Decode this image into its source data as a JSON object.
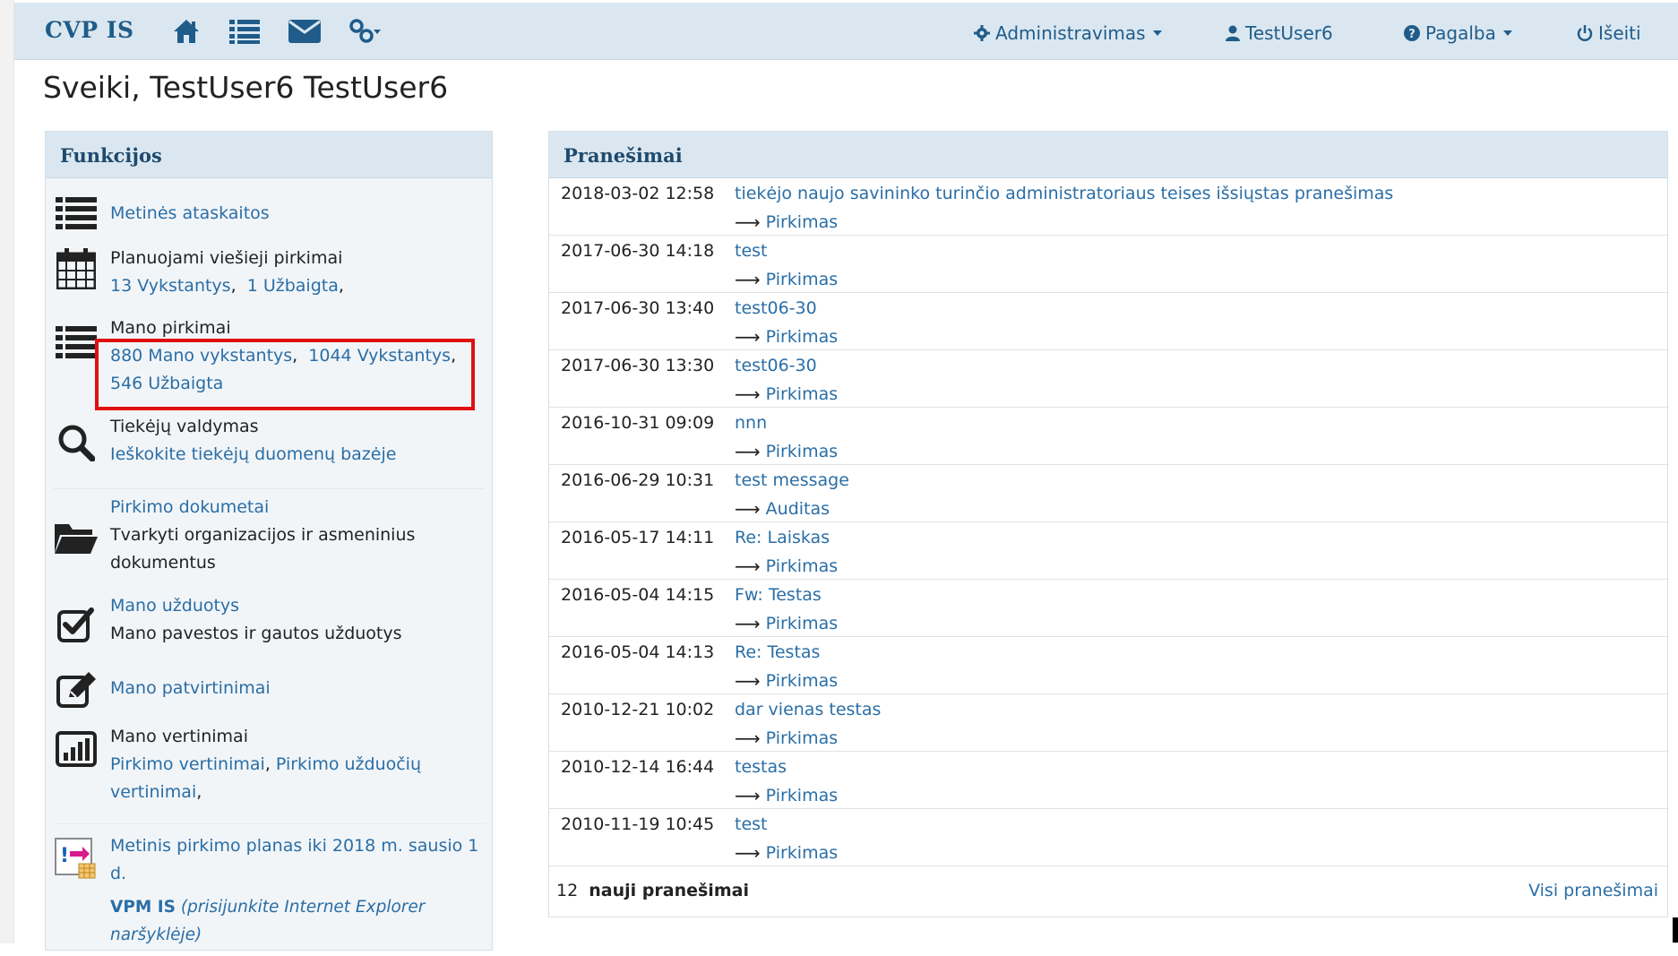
{
  "navbar": {
    "brand": "CVP IS",
    "icons": [
      "home-icon",
      "list-icon",
      "envelope-icon",
      "links-icon"
    ],
    "admin_label": "Administravimas",
    "user_label": "TestUser6",
    "help_label": "Pagalba",
    "logout_label": "Išeiti"
  },
  "greeting": "Sveiki, TestUser6 TestUser6",
  "functions": {
    "title": "Funkcijos",
    "annual_reports": "Metinės ataskaitos",
    "planned": {
      "title": "Planuojami viešieji pirkimai",
      "ongoing": "13 Vykstantys",
      "finished": "1 Užbaigta"
    },
    "my_purchases": {
      "title": "Mano pirkimai",
      "mine_ongoing": "880 Mano vykstantys",
      "ongoing": "1044 Vykstantys",
      "finished": "546 Užbaigta"
    },
    "suppliers": {
      "title": "Tiekėjų valdymas",
      "search": "Ieškokite tiekėjų duomenų bazėje"
    },
    "documents": {
      "title": "Pirkimo dokumetai",
      "description": "Tvarkyti organizacijos ir asmeninius dokumentus"
    },
    "tasks": {
      "title": "Mano užduotys",
      "description": "Mano pavestos ir gautos užduotys"
    },
    "approvals": "Mano patvirtinimai",
    "evaluations": {
      "title": "Mano vertinimai",
      "purchase_eval": "Pirkimo vertinimai",
      "task_eval": "Pirkimo užduočių vertinimai"
    },
    "annual_plan": "Metinis pirkimo planas iki 2018 m. sausio 1 d.",
    "vpm": {
      "title": "VPM IS",
      "note": "(prisijunkite Internet Explorer naršyklėje)"
    }
  },
  "messages": {
    "title": "Pranešimai",
    "rows": [
      {
        "date": "2018-03-02 12:58",
        "subject": "tiekėjo naujo savininko turinčio administratoriaus teises išsiųstas pranešimas",
        "type": "Pirkimas"
      },
      {
        "date": "2017-06-30 14:18",
        "subject": "test",
        "type": "Pirkimas"
      },
      {
        "date": "2017-06-30 13:40",
        "subject": "test06-30",
        "type": "Pirkimas"
      },
      {
        "date": "2017-06-30 13:30",
        "subject": "test06-30",
        "type": "Pirkimas"
      },
      {
        "date": "2016-10-31 09:09",
        "subject": "nnn",
        "type": "Pirkimas"
      },
      {
        "date": "2016-06-29 10:31",
        "subject": "test message",
        "type": "Auditas"
      },
      {
        "date": "2016-05-17 14:11",
        "subject": "Re: Laiskas",
        "type": "Pirkimas"
      },
      {
        "date": "2016-05-04 14:15",
        "subject": "Fw: Testas",
        "type": "Pirkimas"
      },
      {
        "date": "2016-05-04 14:13",
        "subject": "Re: Testas",
        "type": "Pirkimas"
      },
      {
        "date": "2010-12-21 10:02",
        "subject": "dar vienas testas",
        "type": "Pirkimas"
      },
      {
        "date": "2010-12-14 16:44",
        "subject": "testas",
        "type": "Pirkimas"
      },
      {
        "date": "2010-11-19 10:45",
        "subject": "test",
        "type": "Pirkimas"
      }
    ],
    "new_count": "12",
    "new_label": "nauji pranešimai",
    "all_link": "Visi pranešimai"
  },
  "colors": {
    "navbar_bg": "#dbe7f0",
    "link": "#2a6ea6",
    "brand": "#1f5c8a",
    "highlight": "#e01010"
  }
}
